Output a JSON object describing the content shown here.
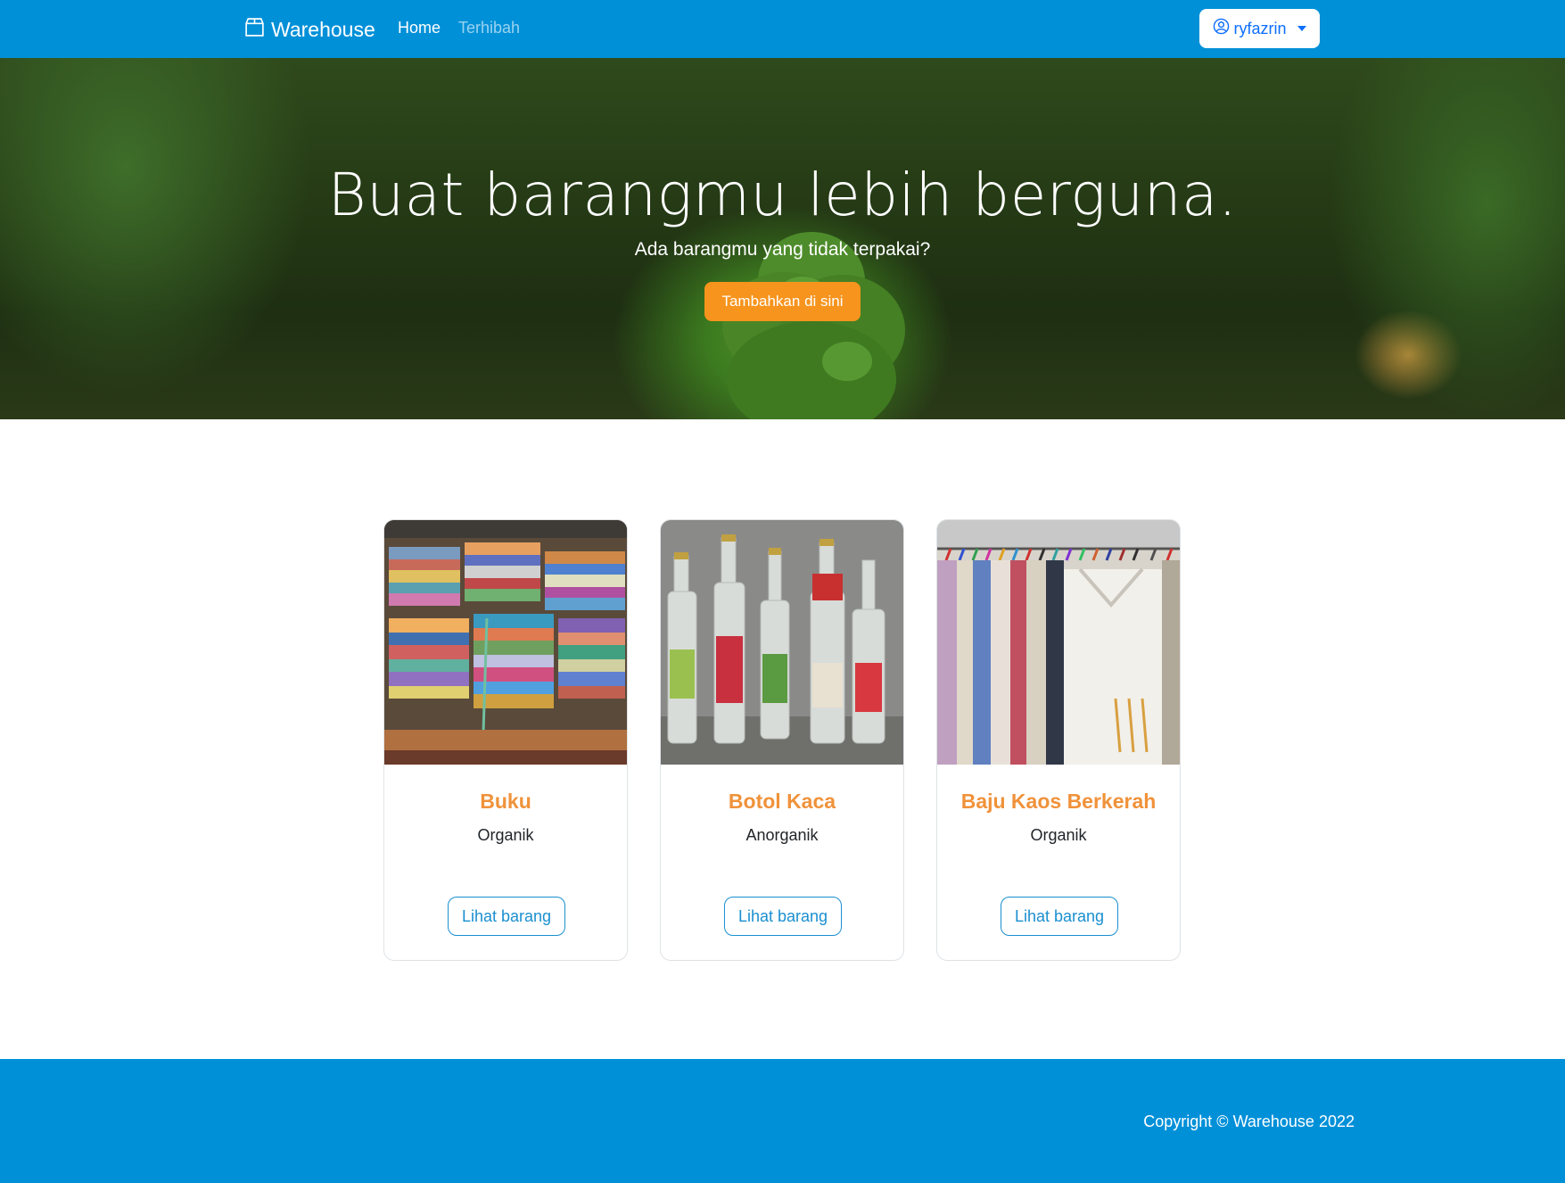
{
  "navbar": {
    "brand": "Warehouse",
    "brand_icon": "box-icon",
    "links": [
      {
        "label": "Home",
        "active": true
      },
      {
        "label": "Terhibah",
        "active": false
      }
    ],
    "user": {
      "name": "ryfazrin",
      "icon": "user-circle-icon"
    },
    "color": "#0090d8"
  },
  "hero": {
    "title": "Buat barangmu lebih berguna.",
    "subtitle": "Ada barangmu yang tidak terpakai?",
    "cta_label": "Tambahkan di sini",
    "cta_color": "#f7941d"
  },
  "items": [
    {
      "name": "Buku",
      "category": "Organik",
      "button": "Lihat barang"
    },
    {
      "name": "Botol Kaca",
      "category": "Anorganik",
      "button": "Lihat barang"
    },
    {
      "name": "Baju Kaos Berkerah",
      "category": "Organik",
      "button": "Lihat barang"
    }
  ],
  "footer": {
    "copyright": "Copyright © Warehouse 2022"
  }
}
